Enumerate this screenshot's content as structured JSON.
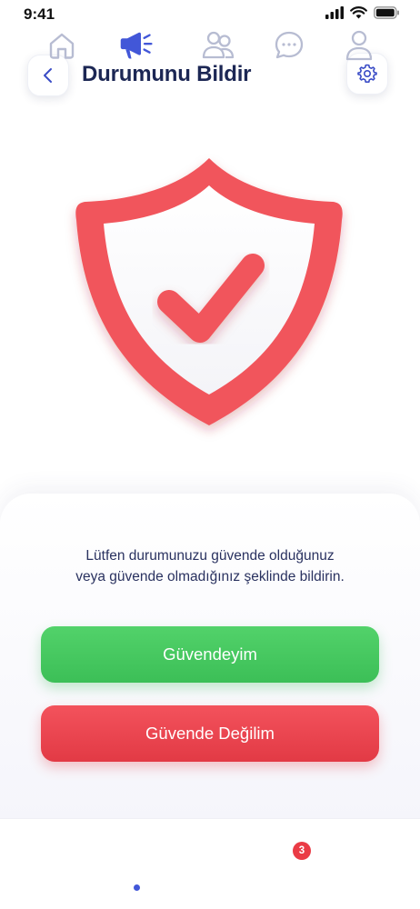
{
  "status_bar": {
    "time": "9:41"
  },
  "header": {
    "title": "Durumunu Bildir"
  },
  "main": {
    "message_line1": "Lütfen durumunuzu güvende olduğunuz",
    "message_line2": "veya güvende olmadığınız şeklinde bildirin.",
    "safe_button_label": "Güvendeyim",
    "unsafe_button_label": "Güvende Değilim"
  },
  "tab_bar": {
    "active_tab": "report",
    "chat_badge_count": "3"
  },
  "colors": {
    "shield_red": "#f1545c",
    "safe_green": "#45c75f",
    "unsafe_red": "#e8404a",
    "active_tab": "#4257d8",
    "inactive_tab": "#b7bcd2",
    "title_navy": "#1c2754"
  }
}
